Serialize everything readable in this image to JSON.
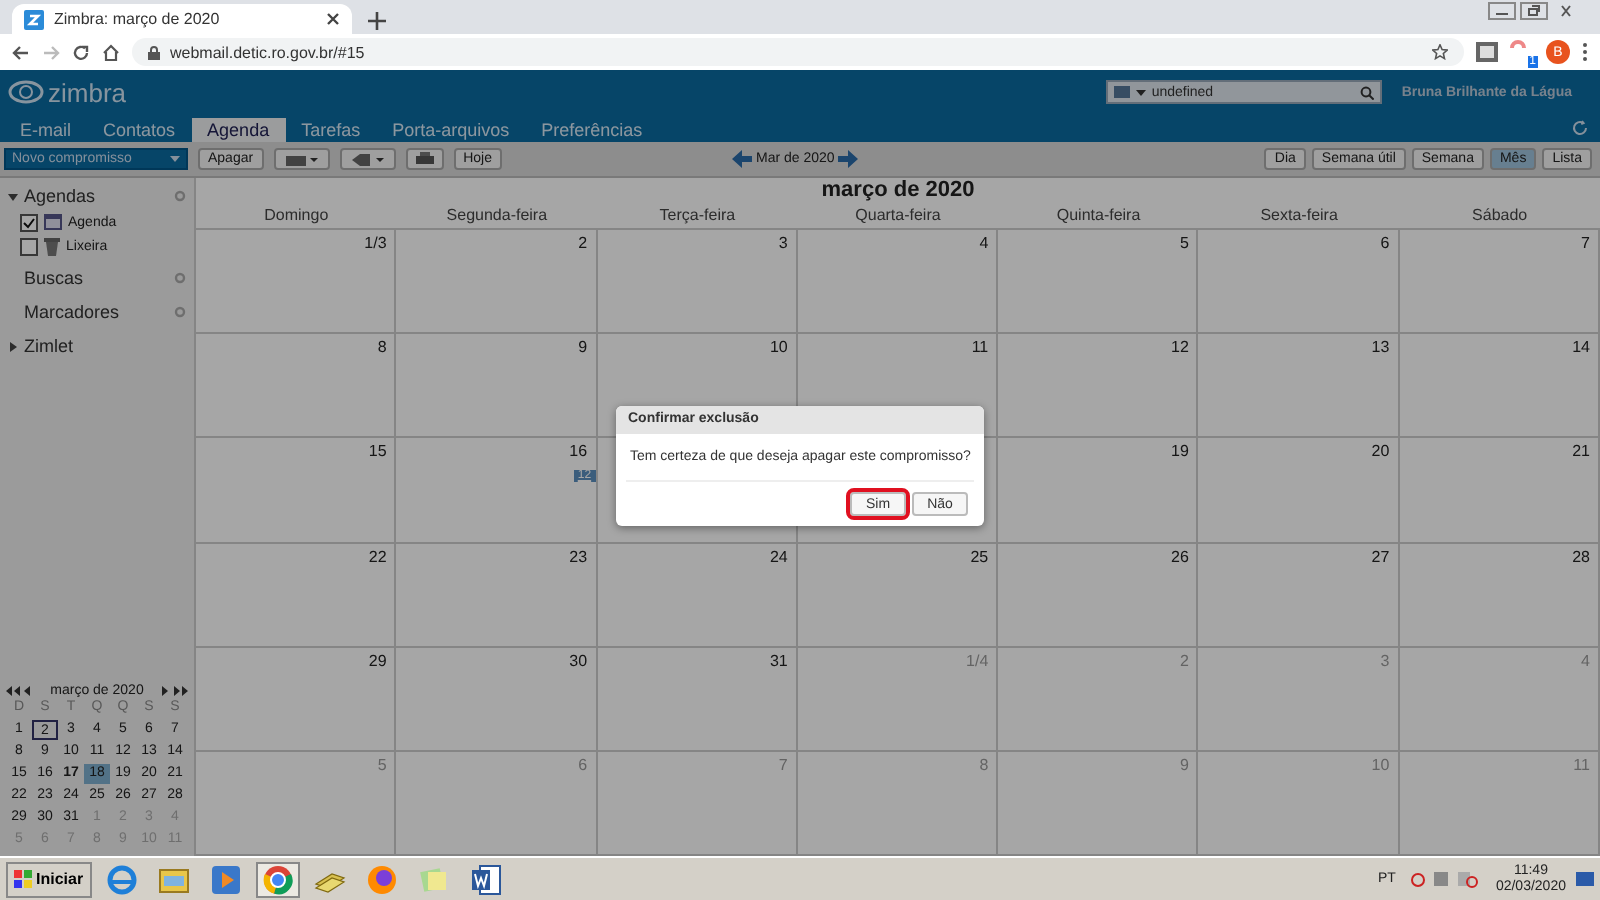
{
  "browser": {
    "tab_title": "Zimbra: março de 2020",
    "url": "webmail.detic.ro.gov.br/#15",
    "extension_badge": "1",
    "profile_initial": "B"
  },
  "header": {
    "logo_text": "zimbra",
    "search_value": "undefined",
    "user": "Bruna Brilhante da Lágua"
  },
  "nav_tabs": [
    {
      "label": "E-mail",
      "selected": false
    },
    {
      "label": "Contatos",
      "selected": false
    },
    {
      "label": "Agenda",
      "selected": true
    },
    {
      "label": "Tarefas",
      "selected": false
    },
    {
      "label": "Porta-arquivos",
      "selected": false
    },
    {
      "label": "Preferências",
      "selected": false
    }
  ],
  "toolbar": {
    "new_button": "Novo compromisso",
    "delete_button": "Apagar",
    "today_button": "Hoje",
    "range": "Mar de 2020",
    "views": [
      {
        "label": "Dia",
        "selected": false
      },
      {
        "label": "Semana útil",
        "selected": false
      },
      {
        "label": "Semana",
        "selected": false
      },
      {
        "label": "Mês",
        "selected": true
      },
      {
        "label": "Lista",
        "selected": false
      }
    ]
  },
  "sidebar": {
    "sections": [
      {
        "label": "Agendas",
        "kind": "tree",
        "expanded": true,
        "children": [
          {
            "label": "Agenda",
            "kind": "calendar",
            "checked": true
          },
          {
            "label": "Lixeira",
            "kind": "trash",
            "checked": false
          }
        ]
      },
      {
        "label": "Buscas",
        "kind": "plain"
      },
      {
        "label": "Marcadores",
        "kind": "plain"
      },
      {
        "label": "Zimlet",
        "kind": "tree",
        "expanded": false
      }
    ]
  },
  "mini_calendar": {
    "title": "março de 2020",
    "weekdays": [
      "D",
      "S",
      "T",
      "Q",
      "Q",
      "S",
      "S"
    ],
    "days": [
      {
        "text": "1",
        "other_month": false,
        "today": false,
        "bold": false,
        "selected": false
      },
      {
        "text": "2",
        "other_month": false,
        "today": true,
        "bold": false,
        "selected": false
      },
      {
        "text": "3",
        "other_month": false,
        "today": false,
        "bold": false,
        "selected": false
      },
      {
        "text": "4",
        "other_month": false,
        "today": false,
        "bold": false,
        "selected": false
      },
      {
        "text": "5",
        "other_month": false,
        "today": false,
        "bold": false,
        "selected": false
      },
      {
        "text": "6",
        "other_month": false,
        "today": false,
        "bold": false,
        "selected": false
      },
      {
        "text": "7",
        "other_month": false,
        "today": false,
        "bold": false,
        "selected": false
      },
      {
        "text": "8",
        "other_month": false,
        "today": false,
        "bold": false,
        "selected": false
      },
      {
        "text": "9",
        "other_month": false,
        "today": false,
        "bold": false,
        "selected": false
      },
      {
        "text": "10",
        "other_month": false,
        "today": false,
        "bold": false,
        "selected": false
      },
      {
        "text": "11",
        "other_month": false,
        "today": false,
        "bold": false,
        "selected": false
      },
      {
        "text": "12",
        "other_month": false,
        "today": false,
        "bold": false,
        "selected": false
      },
      {
        "text": "13",
        "other_month": false,
        "today": false,
        "bold": false,
        "selected": false
      },
      {
        "text": "14",
        "other_month": false,
        "today": false,
        "bold": false,
        "selected": false
      },
      {
        "text": "15",
        "other_month": false,
        "today": false,
        "bold": false,
        "selected": false
      },
      {
        "text": "16",
        "other_month": false,
        "today": false,
        "bold": false,
        "selected": false
      },
      {
        "text": "17",
        "other_month": false,
        "today": false,
        "bold": true,
        "selected": false
      },
      {
        "text": "18",
        "other_month": false,
        "today": false,
        "bold": false,
        "selected": true
      },
      {
        "text": "19",
        "other_month": false,
        "today": false,
        "bold": false,
        "selected": false
      },
      {
        "text": "20",
        "other_month": false,
        "today": false,
        "bold": false,
        "selected": false
      },
      {
        "text": "21",
        "other_month": false,
        "today": false,
        "bold": false,
        "selected": false
      },
      {
        "text": "22",
        "other_month": false,
        "today": false,
        "bold": false,
        "selected": false
      },
      {
        "text": "23",
        "other_month": false,
        "today": false,
        "bold": false,
        "selected": false
      },
      {
        "text": "24",
        "other_month": false,
        "today": false,
        "bold": false,
        "selected": false
      },
      {
        "text": "25",
        "other_month": false,
        "today": false,
        "bold": false,
        "selected": false
      },
      {
        "text": "26",
        "other_month": false,
        "today": false,
        "bold": false,
        "selected": false
      },
      {
        "text": "27",
        "other_month": false,
        "today": false,
        "bold": false,
        "selected": false
      },
      {
        "text": "28",
        "other_month": false,
        "today": false,
        "bold": false,
        "selected": false
      },
      {
        "text": "29",
        "other_month": false,
        "today": false,
        "bold": false,
        "selected": false
      },
      {
        "text": "30",
        "other_month": false,
        "today": false,
        "bold": false,
        "selected": false
      },
      {
        "text": "31",
        "other_month": false,
        "today": false,
        "bold": false,
        "selected": false
      },
      {
        "text": "1",
        "other_month": true,
        "today": false,
        "bold": false,
        "selected": false
      },
      {
        "text": "2",
        "other_month": true,
        "today": false,
        "bold": false,
        "selected": false
      },
      {
        "text": "3",
        "other_month": true,
        "today": false,
        "bold": false,
        "selected": false
      },
      {
        "text": "4",
        "other_month": true,
        "today": false,
        "bold": false,
        "selected": false
      },
      {
        "text": "5",
        "other_month": true,
        "today": false,
        "bold": false,
        "selected": false
      },
      {
        "text": "6",
        "other_month": true,
        "today": false,
        "bold": false,
        "selected": false
      },
      {
        "text": "7",
        "other_month": true,
        "today": false,
        "bold": false,
        "selected": false
      },
      {
        "text": "8",
        "other_month": true,
        "today": false,
        "bold": false,
        "selected": false
      },
      {
        "text": "9",
        "other_month": true,
        "today": false,
        "bold": false,
        "selected": false
      },
      {
        "text": "10",
        "other_month": true,
        "today": false,
        "bold": false,
        "selected": false
      },
      {
        "text": "11",
        "other_month": true,
        "today": false,
        "bold": false,
        "selected": false
      }
    ]
  },
  "calendar": {
    "title": "março de 2020",
    "weekdays": [
      "Domingo",
      "Segunda-feira",
      "Terça-feira",
      "Quarta-feira",
      "Quinta-feira",
      "Sexta-feira",
      "Sábado"
    ],
    "weeks": [
      {
        "days": [
          {
            "text": "1/3",
            "other_month": false
          },
          {
            "text": "2",
            "other_month": false
          },
          {
            "text": "3",
            "other_month": false
          },
          {
            "text": "4",
            "other_month": false
          },
          {
            "text": "5",
            "other_month": false
          },
          {
            "text": "6",
            "other_month": false
          },
          {
            "text": "7",
            "other_month": false
          }
        ]
      },
      {
        "days": [
          {
            "text": "8",
            "other_month": false
          },
          {
            "text": "9",
            "other_month": false
          },
          {
            "text": "10",
            "other_month": false
          },
          {
            "text": "11",
            "other_month": false
          },
          {
            "text": "12",
            "other_month": false
          },
          {
            "text": "13",
            "other_month": false
          },
          {
            "text": "14",
            "other_month": false
          }
        ]
      },
      {
        "days": [
          {
            "text": "15",
            "other_month": false
          },
          {
            "text": "16",
            "other_month": false,
            "event": "12"
          }
        ],
        "days_after_dialog": [
          {
            "text": "19",
            "other_month": false
          },
          {
            "text": "20",
            "other_month": false
          },
          {
            "text": "21",
            "other_month": false
          }
        ]
      },
      {
        "days": [
          {
            "text": "22",
            "other_month": false
          },
          {
            "text": "23",
            "other_month": false
          },
          {
            "text": "24",
            "other_month": false
          },
          {
            "text": "25",
            "other_month": false
          },
          {
            "text": "26",
            "other_month": false
          },
          {
            "text": "27",
            "other_month": false
          },
          {
            "text": "28",
            "other_month": false
          }
        ]
      },
      {
        "days": [
          {
            "text": "29",
            "other_month": false
          },
          {
            "text": "30",
            "other_month": false
          },
          {
            "text": "31",
            "other_month": false
          },
          {
            "text": "1/4",
            "other_month": true
          },
          {
            "text": "2",
            "other_month": true
          },
          {
            "text": "3",
            "other_month": true
          },
          {
            "text": "4",
            "other_month": true
          }
        ]
      },
      {
        "days": [
          {
            "text": "5",
            "other_month": true
          },
          {
            "text": "6",
            "other_month": true
          },
          {
            "text": "7",
            "other_month": true
          },
          {
            "text": "8",
            "other_month": true
          },
          {
            "text": "9",
            "other_month": true
          },
          {
            "text": "10",
            "other_month": true
          },
          {
            "text": "11",
            "other_month": true
          }
        ]
      }
    ]
  },
  "dialog": {
    "title": "Confirmar exclusão",
    "message": "Tem certeza de que deseja apagar este compromisso?",
    "buttons": [
      {
        "label": "Sim",
        "focused": true
      },
      {
        "label": "Não",
        "focused": false
      }
    ]
  },
  "taskbar": {
    "start": "Iniciar",
    "apps": [
      {
        "kind": "globe",
        "active": false
      },
      {
        "kind": "folder",
        "active": false
      },
      {
        "kind": "play",
        "active": false
      },
      {
        "kind": "ring",
        "active": true
      },
      {
        "kind": "stack",
        "active": false
      },
      {
        "kind": "orb",
        "active": false
      },
      {
        "kind": "notes",
        "active": false
      },
      {
        "kind": "document",
        "active": false
      }
    ],
    "language": "PT",
    "time": "11:49",
    "date": "02/03/2020"
  }
}
